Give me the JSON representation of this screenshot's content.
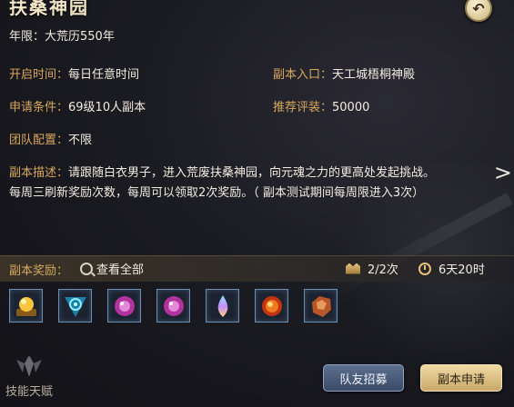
{
  "title": "扶桑神园",
  "info": {
    "years_label": "年限：",
    "years_value": "大荒历550年",
    "open_time_label": "开启时间：",
    "open_time_value": "每日任意时间",
    "entrance_label": "副本入口：",
    "entrance_value": "天工城梧桐神殿",
    "requirement_label": "申请条件：",
    "requirement_value": "69级10人副本",
    "rating_label": "推荐评装：",
    "rating_value": "50000",
    "team_label": "团队配置：",
    "team_value": "不限",
    "desc_label": "副本描述：",
    "desc_line1": "请跟随白衣男子，进入荒废扶桑神园，向元魂之力的更高处发起挑战。",
    "desc_line2": "每周三刷新奖励次数，每周可以领取2次奖励。（ 副本测试期间每周限进入3次）"
  },
  "rewards": {
    "label": "副本奖励：",
    "view_all": "查看全部",
    "count": "2/2次",
    "time": "6天20时",
    "items": [
      "golden-orb-item",
      "blue-rune-item",
      "purple-orb-item",
      "purple-orb-item",
      "rainbow-crystal-item",
      "fire-orb-item",
      "copper-ore-item"
    ]
  },
  "skill": {
    "label": "技能天赋"
  },
  "buttons": {
    "team": "队友招募",
    "apply": "副本申请"
  },
  "icons": {
    "back": "back-arrow-icon",
    "next": "chevron-right-icon"
  }
}
